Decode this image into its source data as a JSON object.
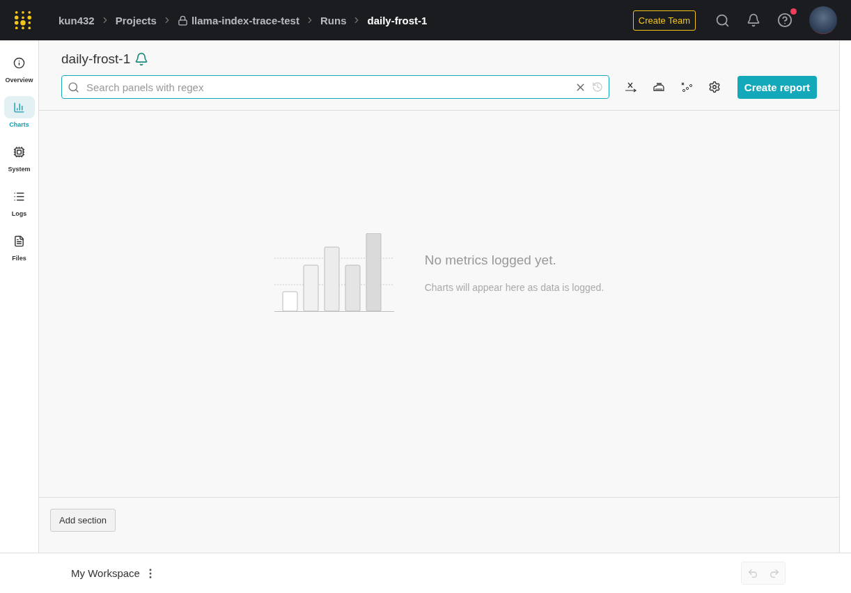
{
  "breadcrumbs": [
    {
      "label": "kun432",
      "current": false,
      "locked": false
    },
    {
      "label": "Projects",
      "current": false,
      "locked": false
    },
    {
      "label": "llama-index-trace-test",
      "current": false,
      "locked": true
    },
    {
      "label": "Runs",
      "current": false,
      "locked": false
    },
    {
      "label": "daily-frost-1",
      "current": true,
      "locked": false
    }
  ],
  "top_bar": {
    "create_team": "Create Team",
    "help_notification": true
  },
  "sidebar": {
    "items": [
      {
        "kind": "overview",
        "label": "Overview",
        "selected": false
      },
      {
        "kind": "charts",
        "label": "Charts",
        "selected": true
      },
      {
        "kind": "system",
        "label": "System",
        "selected": false
      },
      {
        "kind": "logs",
        "label": "Logs",
        "selected": false
      },
      {
        "kind": "files",
        "label": "Files",
        "selected": false
      }
    ]
  },
  "run_title": "daily-frost-1",
  "search": {
    "placeholder": "Search panels with regex"
  },
  "create_report": "Create report",
  "empty_state": {
    "title": "No metrics logged yet.",
    "subtitle": "Charts will appear here as data is logged."
  },
  "add_section": "Add section",
  "footer": {
    "workspace": "My Workspace",
    "undo_disabled": true,
    "redo_disabled": true
  }
}
